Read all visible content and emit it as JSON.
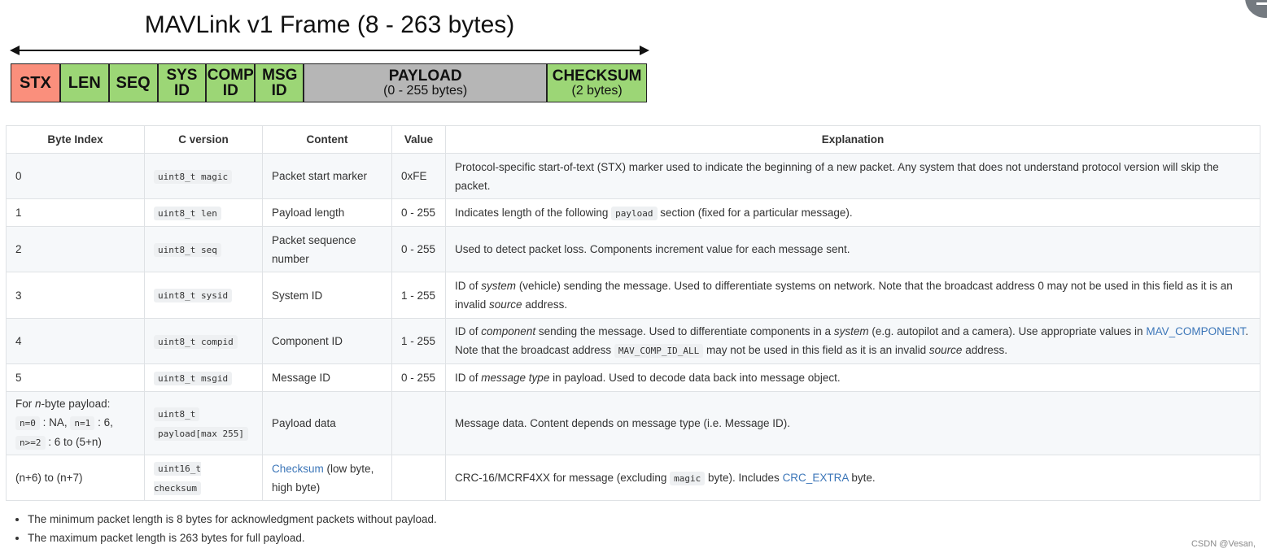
{
  "frame": {
    "title": "MAVLink v1 Frame (8 - 263 bytes)",
    "fields": [
      {
        "label": "STX",
        "color": "#fa8f7c"
      },
      {
        "label": "LEN",
        "color": "#9cd676"
      },
      {
        "label": "SEQ",
        "color": "#9cd676"
      },
      {
        "label": "SYS ID",
        "color": "#9cd676"
      },
      {
        "label": "COMP ID",
        "color": "#9cd676"
      },
      {
        "label": "MSG ID",
        "color": "#9cd676"
      },
      {
        "label": "PAYLOAD",
        "sub": "(0 - 255 bytes)",
        "color": "#b6b6b6"
      },
      {
        "label": "CHECKSUM",
        "sub": "(2 bytes)",
        "color": "#9cd676"
      }
    ]
  },
  "table": {
    "headers": [
      "Byte Index",
      "C version",
      "Content",
      "Value",
      "Explanation"
    ],
    "rows": [
      {
        "index": "0",
        "cver": "uint8_t magic",
        "content": "Packet start marker",
        "value": "0xFE",
        "explanation": "Protocol-specific start-of-text (STX) marker used to indicate the beginning of a new packet. Any system that does not understand protocol version will skip the packet."
      },
      {
        "index": "1",
        "cver": "uint8_t len",
        "content": "Payload length",
        "value": "0 - 255",
        "exp_a": "Indicates length of the following",
        "exp_code": "payload",
        "exp_b": "section (fixed for a particular message)."
      },
      {
        "index": "2",
        "cver": "uint8_t seq",
        "content": "Packet sequence number",
        "value": "0 - 255",
        "explanation": "Used to detect packet loss. Components increment value for each message sent."
      },
      {
        "index": "3",
        "cver": "uint8_t sysid",
        "content": "System ID",
        "value": "1 - 255",
        "exp_a": "ID of",
        "exp_em1": "system",
        "exp_b": "(vehicle) sending the message. Used to differentiate systems on network. Note that the broadcast address 0 may not be used in this field as it is an invalid",
        "exp_em2": "source",
        "exp_c": "address."
      },
      {
        "index": "4",
        "cver": "uint8_t compid",
        "content": "Component ID",
        "value": "1 - 255",
        "exp_a": "ID of",
        "exp_em1": "component",
        "exp_b": "sending the message. Used to differentiate components in a",
        "exp_em2": "system",
        "exp_c": "(e.g. autopilot and a camera). Use appropriate values in",
        "exp_link": "MAV_COMPONENT",
        "exp_d": ". Note that the broadcast address",
        "exp_code": "MAV_COMP_ID_ALL",
        "exp_e": "may not be used in this field as it is an invalid",
        "exp_em3": "source",
        "exp_f": "address."
      },
      {
        "index": "5",
        "cver": "uint8_t msgid",
        "content": "Message ID",
        "value": "0 - 255",
        "exp_a": "ID of",
        "exp_em1": "message type",
        "exp_b": "in payload. Used to decode data back into message object."
      },
      {
        "index_a": "For",
        "index_em": "n",
        "index_b": "-byte payload:",
        "index_c1": "n=0",
        "index_t1": ": NA,",
        "index_c2": "n=1",
        "index_t2": ": 6,",
        "index_c3": "n>=2",
        "index_t3": ": 6 to (5+n)",
        "cver_a": "uint8_t",
        "cver_b": "payload[max 255]",
        "content": "Payload data",
        "value": "",
        "explanation": "Message data. Content depends on message type (i.e. Message ID)."
      },
      {
        "index": "(n+6) to (n+7)",
        "cver": "uint16_t checksum",
        "content_link": "Checksum",
        "content_rest": "(low byte, high byte)",
        "value": "",
        "exp_a": "CRC-16/MCRF4XX for message (excluding",
        "exp_code": "magic",
        "exp_b": "byte). Includes",
        "exp_link": "CRC_EXTRA",
        "exp_c": "byte."
      }
    ]
  },
  "notes": [
    "The minimum packet length is 8 bytes for acknowledgment packets without payload.",
    "The maximum packet length is 263 bytes for full payload."
  ],
  "watermark": "CSDN @Vesan,"
}
